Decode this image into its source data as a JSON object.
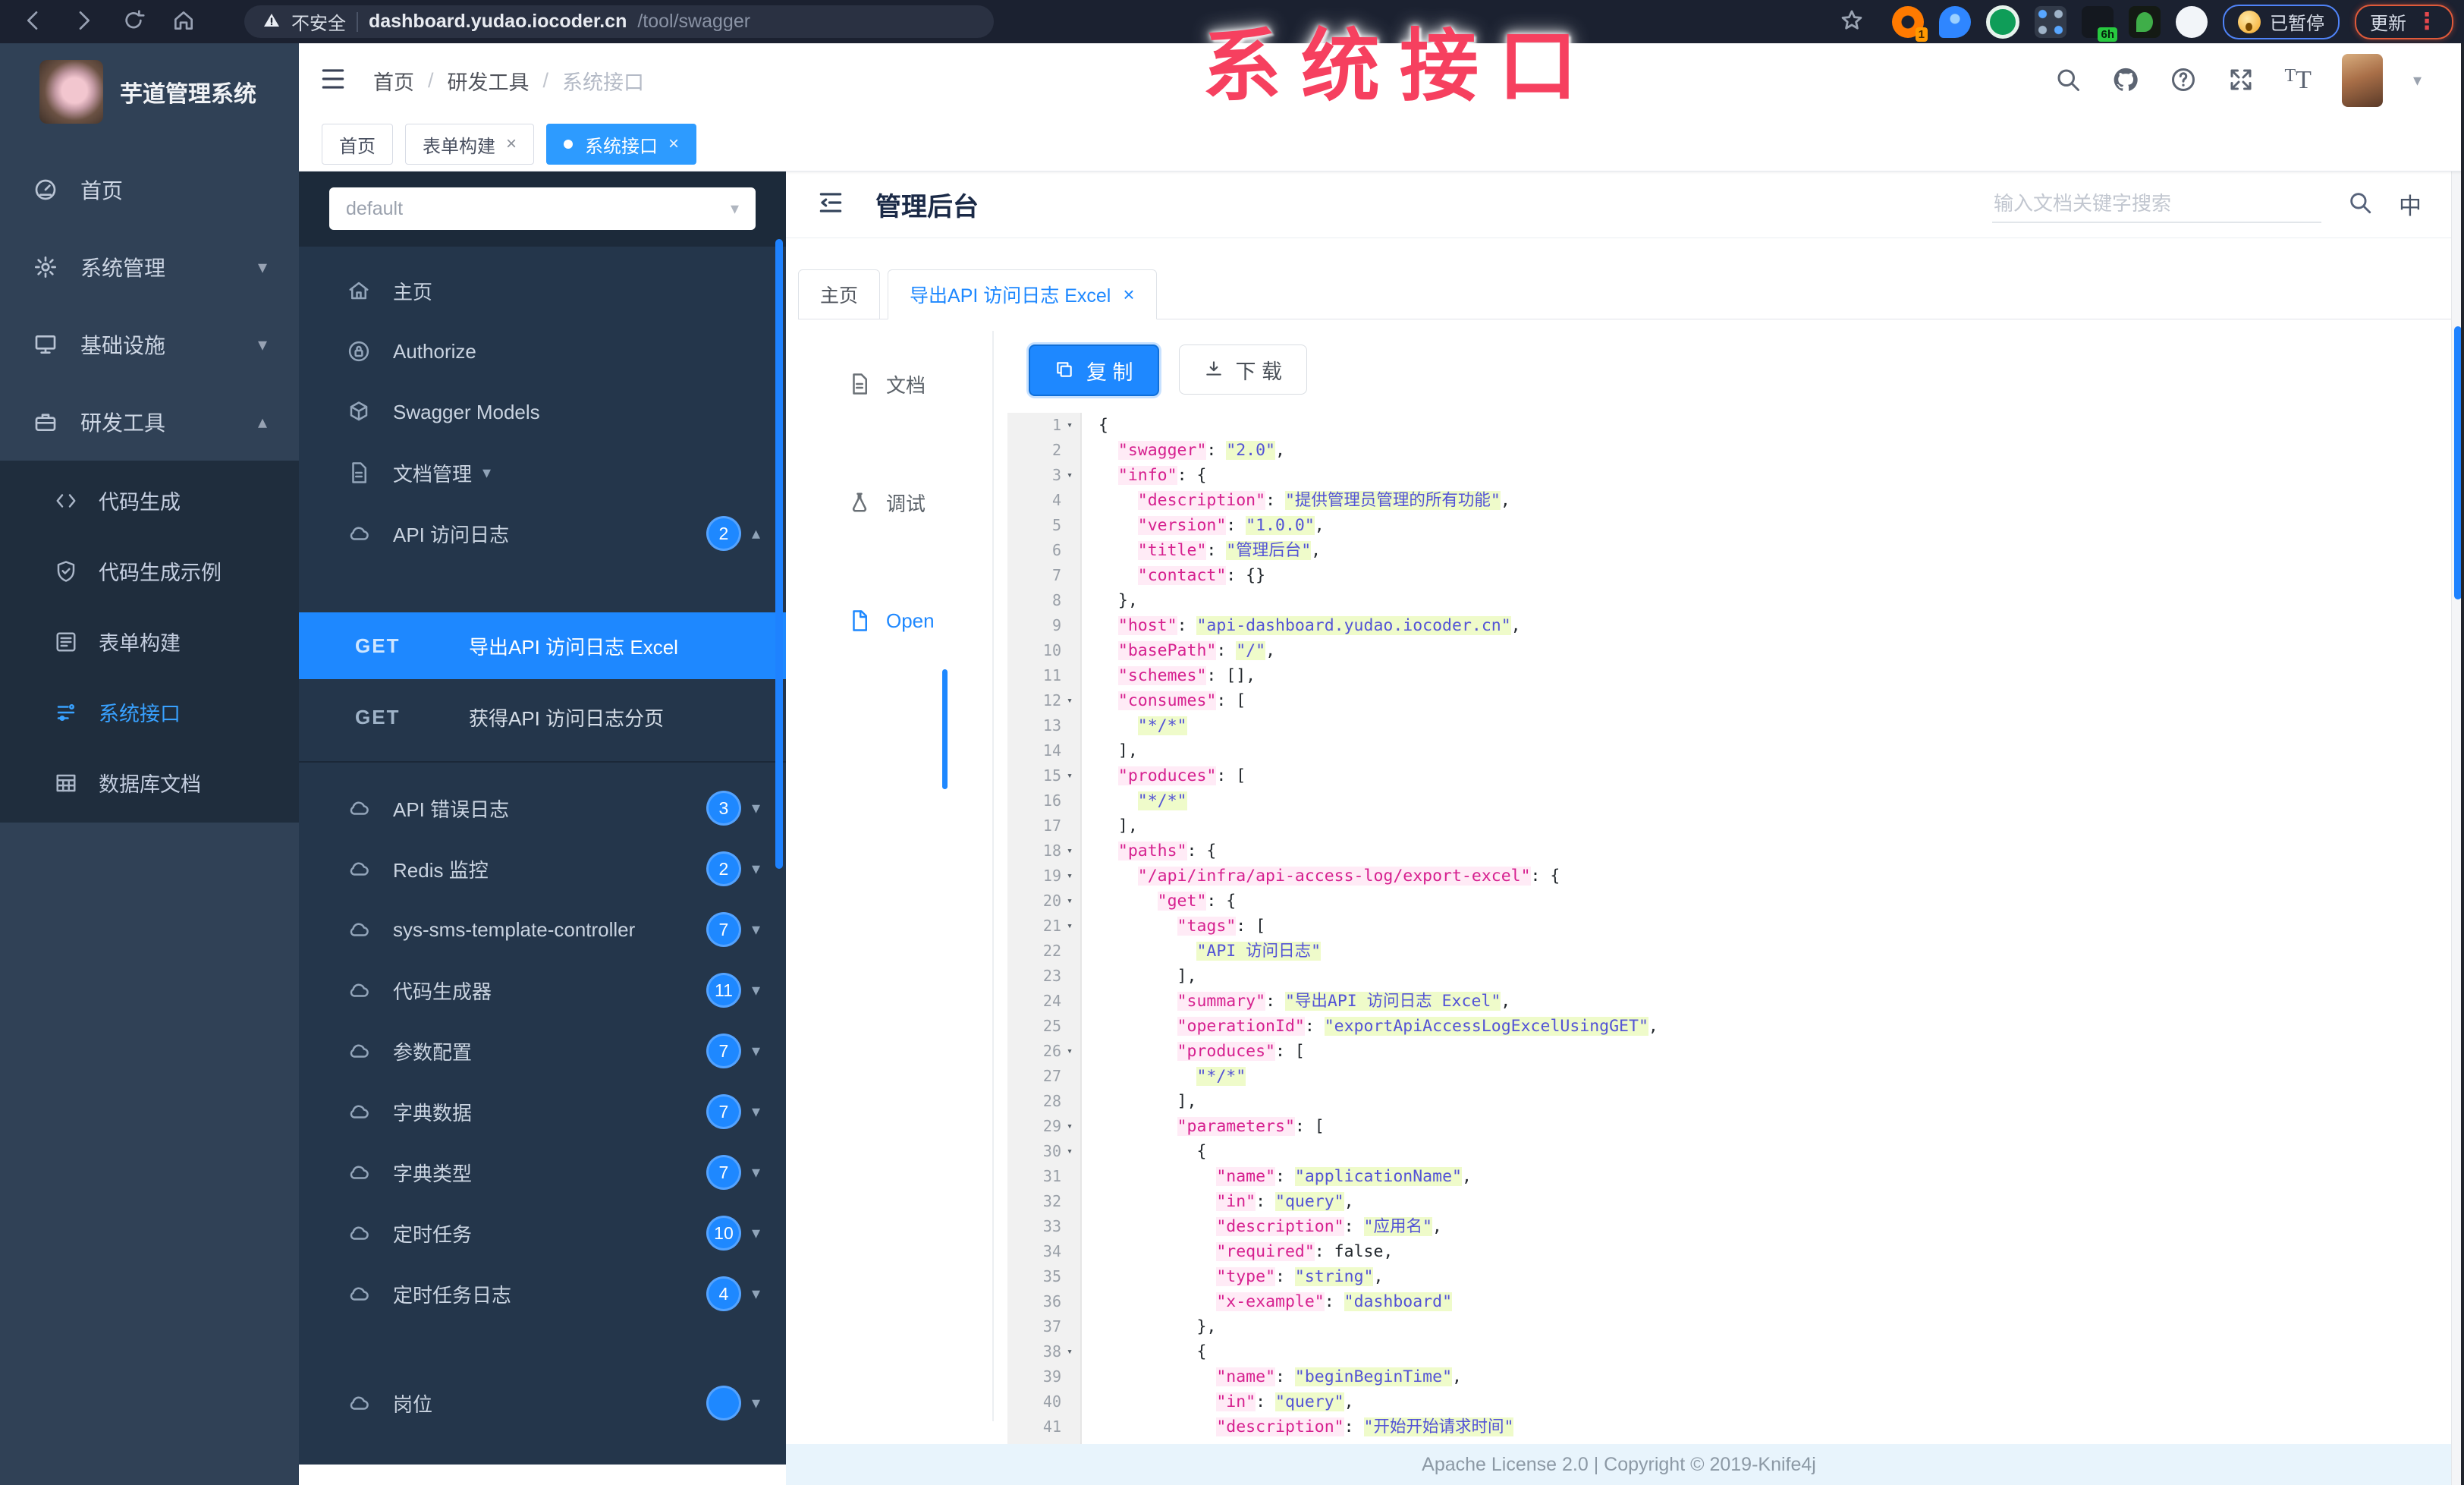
{
  "browser": {
    "security_label": "不安全",
    "url_host": "dashboard.yudao.iocoder.cn",
    "url_path": "/tool/swagger",
    "ext1_badge": "1",
    "ext_6h_badge": "6h",
    "paused_label": "已暂停",
    "update_label": "更新"
  },
  "overlay": {
    "title": "系统接口"
  },
  "sidebar": {
    "brand": "芋道管理系统",
    "items": [
      {
        "icon": "dashboard",
        "label": "首页"
      },
      {
        "icon": "gear",
        "label": "系统管理",
        "chevron": "down"
      },
      {
        "icon": "infra",
        "label": "基础设施",
        "chevron": "down"
      },
      {
        "icon": "tool",
        "label": "研发工具",
        "chevron": "up"
      }
    ],
    "subitems": [
      {
        "icon": "code",
        "label": "代码生成"
      },
      {
        "icon": "shield",
        "label": "代码生成示例"
      },
      {
        "icon": "form",
        "label": "表单构建"
      },
      {
        "icon": "swagger",
        "label": "系统接口",
        "active": true
      },
      {
        "icon": "table",
        "label": "数据库文档"
      }
    ]
  },
  "navbar": {
    "breadcrumb": [
      "首页",
      "研发工具",
      "系统接口"
    ]
  },
  "tags": [
    {
      "label": "首页"
    },
    {
      "label": "表单构建",
      "closable": true
    },
    {
      "label": "系统接口",
      "closable": true,
      "active": true
    }
  ],
  "swagger_sidebar": {
    "group_select": "default",
    "items": [
      {
        "type": "item",
        "icon": "home",
        "label": "主页"
      },
      {
        "type": "item",
        "icon": "lock",
        "label": "Authorize"
      },
      {
        "type": "item",
        "icon": "cube",
        "label": "Swagger Models"
      },
      {
        "type": "item",
        "icon": "filedoc",
        "label": "文档管理",
        "chevron": "down"
      },
      {
        "type": "item",
        "icon": "cloud",
        "label": "API 访问日志",
        "badge": "2",
        "chevron": "up"
      },
      {
        "type": "get",
        "method": "GET",
        "label": "导出API 访问日志 Excel",
        "active": true,
        "first": true
      },
      {
        "type": "get",
        "method": "GET",
        "label": "获得API 访问日志分页",
        "divider": true
      },
      {
        "type": "item",
        "icon": "cloud",
        "label": "API 错误日志",
        "badge": "3",
        "chevron": "down"
      },
      {
        "type": "item",
        "icon": "cloud",
        "label": "Redis 监控",
        "badge": "2",
        "chevron": "down"
      },
      {
        "type": "item",
        "icon": "cloud",
        "label": "sys-sms-template-controller",
        "badge": "7",
        "chevron": "down"
      },
      {
        "type": "item",
        "icon": "cloud",
        "label": "代码生成器",
        "badge": "11",
        "chevron": "down"
      },
      {
        "type": "item",
        "icon": "cloud",
        "label": "参数配置",
        "badge": "7",
        "chevron": "down"
      },
      {
        "type": "item",
        "icon": "cloud",
        "label": "字典数据",
        "badge": "7",
        "chevron": "down"
      },
      {
        "type": "item",
        "icon": "cloud",
        "label": "字典类型",
        "badge": "7",
        "chevron": "down"
      },
      {
        "type": "item",
        "icon": "cloud",
        "label": "定时任务",
        "badge": "10",
        "chevron": "down"
      },
      {
        "type": "item",
        "icon": "cloud",
        "label": "定时任务日志",
        "badge": "4",
        "chevron": "down"
      },
      {
        "type": "item",
        "icon": "cloud",
        "label": "岗位",
        "badge": "",
        "chevron": "down",
        "partial": true
      }
    ]
  },
  "content": {
    "title": "管理后台",
    "search_placeholder": "输入文档关键字搜索",
    "lang_icon": "中",
    "tabs": [
      {
        "label": "主页"
      },
      {
        "label": "导出API 访问日志 Excel",
        "closable": true,
        "active": true
      }
    ],
    "doc_menu": [
      {
        "icon": "filedoc",
        "label": "文档"
      },
      {
        "icon": "debug",
        "label": "调试"
      },
      {
        "icon": "file",
        "label": "Open",
        "active": true
      }
    ],
    "copy_label": "复 制",
    "download_label": "下 载",
    "footer": "Apache License 2.0 | Copyright © 2019-Knife4j"
  },
  "code": {
    "fold_lines": [
      1,
      3,
      12,
      15,
      18,
      19,
      20,
      21,
      26,
      29,
      30,
      38
    ],
    "lines": [
      "{",
      "  \"swagger\": \"2.0\",",
      "  \"info\": {",
      "    \"description\": \"提供管理员管理的所有功能\",",
      "    \"version\": \"1.0.0\",",
      "    \"title\": \"管理后台\",",
      "    \"contact\": {}",
      "  },",
      "  \"host\": \"api-dashboard.yudao.iocoder.cn\",",
      "  \"basePath\": \"/\",",
      "  \"schemes\": [],",
      "  \"consumes\": [",
      "    \"*/*\"",
      "  ],",
      "  \"produces\": [",
      "    \"*/*\"",
      "  ],",
      "  \"paths\": {",
      "    \"/api/infra/api-access-log/export-excel\": {",
      "      \"get\": {",
      "        \"tags\": [",
      "          \"API 访问日志\"",
      "        ],",
      "        \"summary\": \"导出API 访问日志 Excel\",",
      "        \"operationId\": \"exportApiAccessLogExcelUsingGET\",",
      "        \"produces\": [",
      "          \"*/*\"",
      "        ],",
      "        \"parameters\": [",
      "          {",
      "            \"name\": \"applicationName\",",
      "            \"in\": \"query\",",
      "            \"description\": \"应用名\",",
      "            \"required\": false,",
      "            \"type\": \"string\",",
      "            \"x-example\": \"dashboard\"",
      "          },",
      "          {",
      "            \"name\": \"beginBeginTime\",",
      "            \"in\": \"query\",",
      "            \"description\": \"开始开始请求时间\""
    ]
  }
}
